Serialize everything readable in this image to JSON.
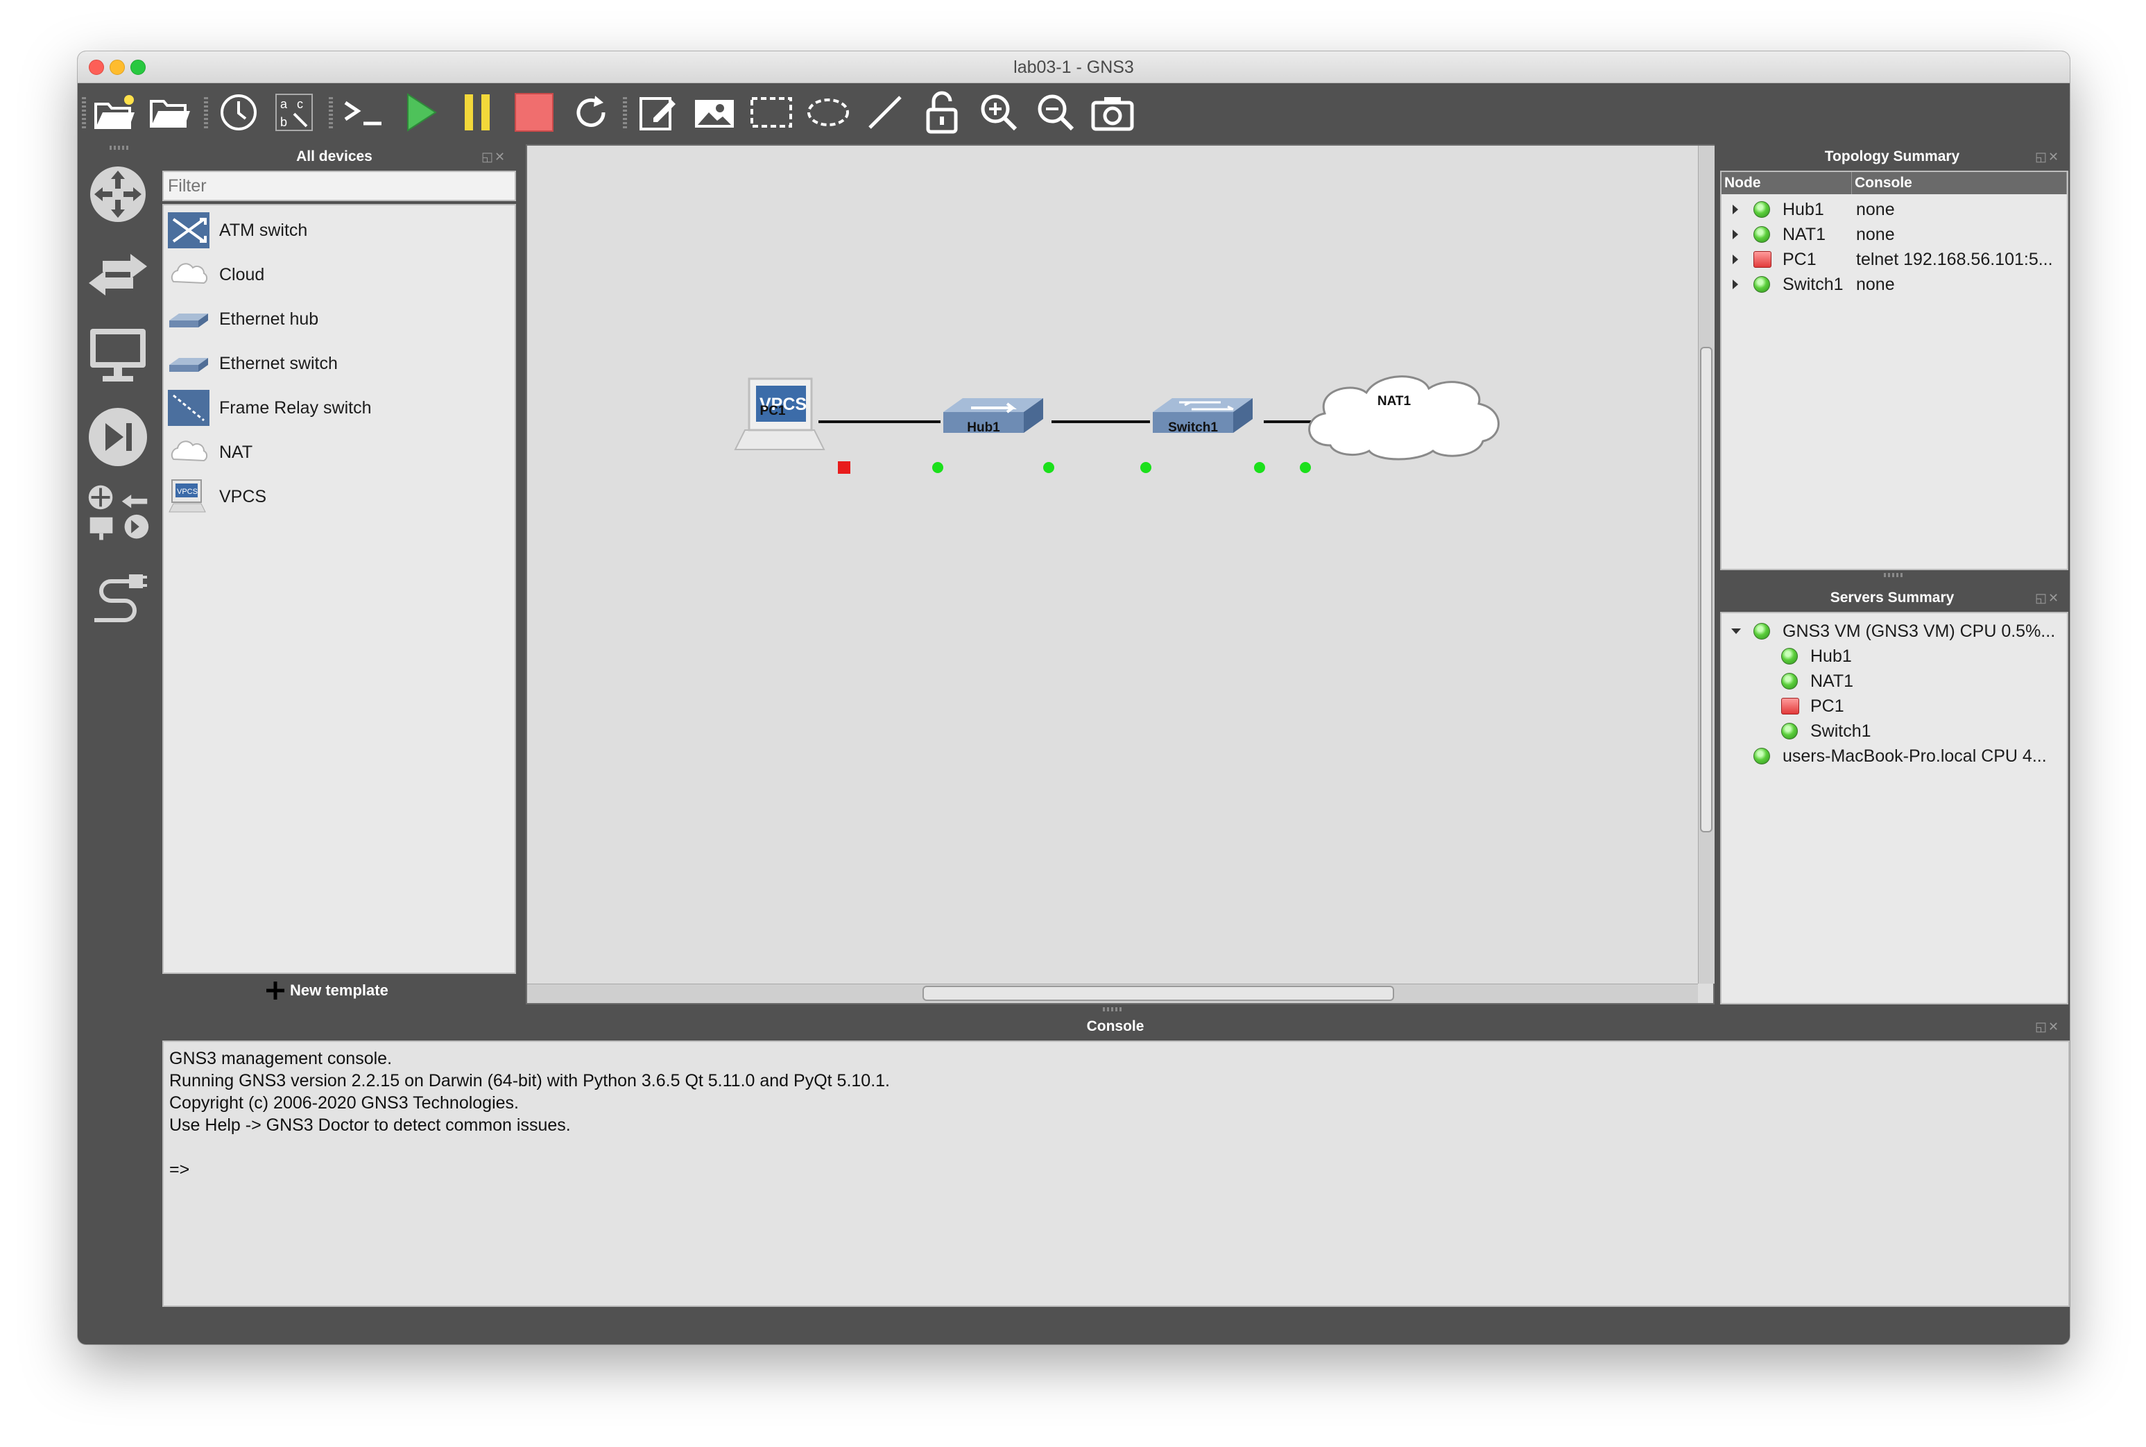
{
  "window": {
    "title": "lab03-1 - GNS3"
  },
  "toolbar": {
    "buttons": [
      "new-project",
      "open-project",
      "snapshot",
      "show-hide-interface-labels",
      "console-all",
      "start-all",
      "suspend-all",
      "stop-all",
      "reload-all",
      "add-note",
      "insert-picture",
      "draw-rectangle",
      "draw-ellipse",
      "draw-line",
      "lock-items",
      "zoom-in",
      "zoom-out",
      "screenshot"
    ]
  },
  "devices_panel": {
    "title": "All devices",
    "filter_placeholder": "Filter",
    "items": [
      {
        "label": "ATM switch",
        "icon": "atm-switch-icon"
      },
      {
        "label": "Cloud",
        "icon": "cloud-icon"
      },
      {
        "label": "Ethernet hub",
        "icon": "ethernet-hub-icon"
      },
      {
        "label": "Ethernet switch",
        "icon": "ethernet-switch-icon"
      },
      {
        "label": "Frame Relay switch",
        "icon": "frame-relay-switch-icon"
      },
      {
        "label": "NAT",
        "icon": "nat-cloud-icon"
      },
      {
        "label": "VPCS",
        "icon": "vpcs-icon"
      }
    ],
    "new_template_label": "New template"
  },
  "topology": {
    "nodes": {
      "pc1": {
        "label": "PC1",
        "badge": "VPCS"
      },
      "hub1": {
        "label": "Hub1"
      },
      "switch1": {
        "label": "Switch1"
      },
      "nat1": {
        "label": "NAT1"
      }
    },
    "colors": {
      "port_up": "#1be01b",
      "port_down": "#e81c1c",
      "link": "#111111"
    }
  },
  "topology_summary": {
    "title": "Topology Summary",
    "headers": [
      "Node",
      "Console"
    ],
    "rows": [
      {
        "node": "Hub1",
        "console": "none",
        "status": "started"
      },
      {
        "node": "NAT1",
        "console": "none",
        "status": "started"
      },
      {
        "node": "PC1",
        "console": "telnet 192.168.56.101:5...",
        "status": "stopped"
      },
      {
        "node": "Switch1",
        "console": "none",
        "status": "started"
      }
    ]
  },
  "servers_summary": {
    "title": "Servers Summary",
    "server": "GNS3 VM (GNS3 VM) CPU 0.5%...",
    "children": [
      {
        "name": "Hub1",
        "status": "started"
      },
      {
        "name": "NAT1",
        "status": "started"
      },
      {
        "name": "PC1",
        "status": "stopped"
      },
      {
        "name": "Switch1",
        "status": "started"
      }
    ],
    "local": "users-MacBook-Pro.local CPU 4..."
  },
  "console": {
    "title": "Console",
    "lines": [
      "GNS3 management console.",
      "Running GNS3 version 2.2.15 on Darwin (64-bit) with Python 3.6.5 Qt 5.11.0 and PyQt 5.10.1.",
      "Copyright (c) 2006-2020 GNS3 Technologies.",
      "Use Help -> GNS3 Doctor to detect common issues.",
      "",
      "=>"
    ]
  }
}
